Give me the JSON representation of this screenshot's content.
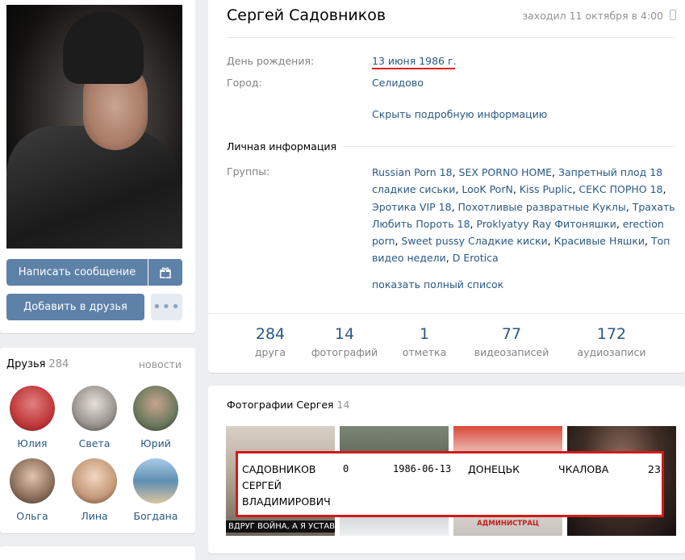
{
  "profile": {
    "name": "Сергей Садовников",
    "last_seen": "заходил 11 октября в 4:00",
    "birthday_label": "День рождения:",
    "birthday_value": "13 июня 1986 г.",
    "city_label": "Город:",
    "city_value": "Селидово",
    "hide_info": "Скрыть подробную информацию",
    "personal_title": "Личная информация",
    "groups_label": "Группы:",
    "groups": [
      "Russian Porn 18",
      "SEX PORNO HOME",
      "Запретный плод 18 сладкие сиськи",
      "LooK PorN",
      "Kiss Puplic",
      "СЕКС ПОРНО 18",
      "Эротика VIP 18",
      "Похотливые развратные Куклы",
      "Трахать Любить Пороть 18",
      "Proklyatyy Ray Фитоняшки",
      "erection porn",
      "Sweet pussy Сладкие киски",
      "Красивые Няшки",
      "Топ видео недели",
      "D Erotica"
    ],
    "show_full_list": "показать полный список"
  },
  "actions": {
    "message": "Написать сообщение",
    "add_friend": "Добавить в друзья",
    "more": "•••"
  },
  "stats": [
    {
      "num": "284",
      "label": "друга"
    },
    {
      "num": "14",
      "label": "фотографий"
    },
    {
      "num": "1",
      "label": "отметка"
    },
    {
      "num": "77",
      "label": "видеозаписей"
    },
    {
      "num": "172",
      "label": "аудиозаписи"
    }
  ],
  "friends": {
    "title": "Друзья",
    "count": "284",
    "news": "новости",
    "items": [
      {
        "name": "Юлия",
        "color": "#c0393b"
      },
      {
        "name": "Света",
        "color": "#9a9590"
      },
      {
        "name": "Юрий",
        "color": "#6b7a5e"
      },
      {
        "name": "Ольга",
        "color": "#8a6f5c"
      },
      {
        "name": "Лина",
        "color": "#c49a7a"
      },
      {
        "name": "Богдана",
        "color": "#5f8fb3"
      }
    ]
  },
  "photos": {
    "title": "Фотографии Сергея",
    "count": "14",
    "caption1": "ВДРУГ ВОЙНА, А Я УСТАВШИ",
    "caption3": "АДМИНИСТРАЦ"
  },
  "record": {
    "name_lines": [
      "САДОВНИКОВ",
      "СЕРГЕЙ",
      "ВЛАДИМИРОВИЧ"
    ],
    "col0": "0",
    "date": "1986-06-13",
    "city": "ДОНЕЦЬК",
    "street": "ЧКАЛОВА",
    "num": "23"
  },
  "colors": {
    "accent": "#2a5885",
    "button": "#5e81a8",
    "highlight_red": "#d11a1a"
  }
}
